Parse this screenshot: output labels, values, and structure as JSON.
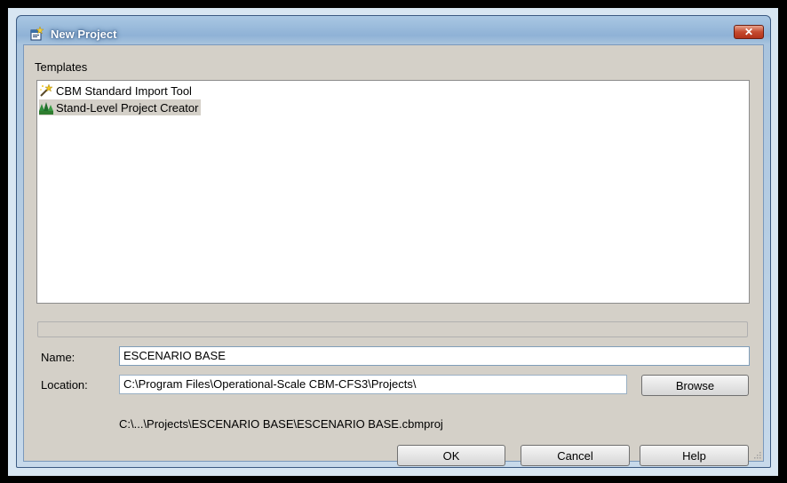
{
  "window": {
    "title": "New Project",
    "close_label": "✕"
  },
  "templates": {
    "label": "Templates",
    "items": [
      {
        "label": "CBM Standard Import Tool",
        "icon": "wand-icon",
        "selected": false
      },
      {
        "label": "Stand-Level Project Creator",
        "icon": "forest-stand-icon",
        "selected": true
      }
    ]
  },
  "progress": {
    "value": 0
  },
  "form": {
    "name_label": "Name:",
    "name_value": "ESCENARIO BASE",
    "location_label": "Location:",
    "location_value": "C:\\Program Files\\Operational-Scale CBM-CFS3\\Projects\\",
    "browse_label": "Browse",
    "resolved_path": "C:\\...\\Projects\\ESCENARIO BASE\\ESCENARIO BASE.cbmproj"
  },
  "buttons": {
    "ok_label": "OK",
    "cancel_label": "Cancel",
    "help_label": "Help"
  },
  "colors": {
    "title_bar": "#8fb2d6",
    "close_button": "#c54a2e",
    "dialog_face": "#d4d0c8",
    "selection": "#d4d0c8"
  }
}
